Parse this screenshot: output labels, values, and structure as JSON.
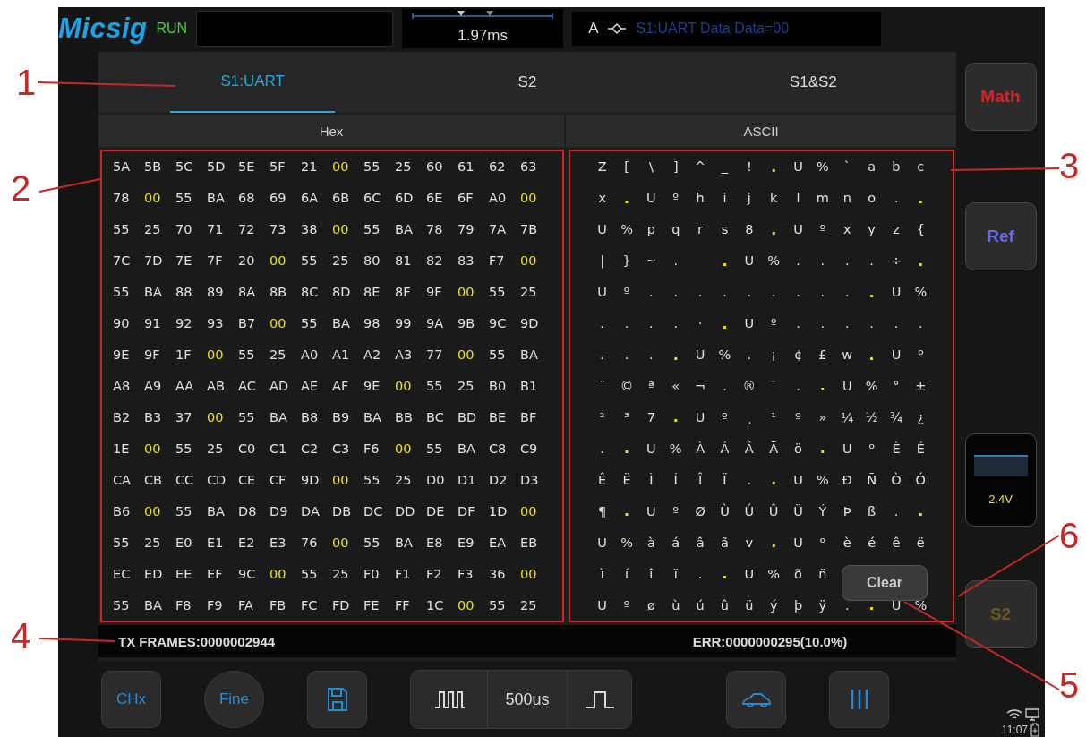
{
  "top_bar": {
    "logo": "Micsig",
    "run_state": "RUN",
    "timebase_position": "1.97ms",
    "trigger_source": "A",
    "trigger_description": "S1:UART Data Data=00"
  },
  "tabs": [
    {
      "label": "S1:UART",
      "selected": true
    },
    {
      "label": "S2",
      "selected": false
    },
    {
      "label": "S1&S2",
      "selected": false
    }
  ],
  "hex_panel": {
    "header": "Hex",
    "rows": [
      {
        "cells": [
          "5A",
          "5B",
          "5C",
          "5D",
          "5E",
          "5F",
          "21",
          "00",
          "55",
          "25",
          "60",
          "61",
          "62",
          "63"
        ],
        "highlighted": [
          false,
          false,
          false,
          false,
          false,
          false,
          false,
          true,
          false,
          false,
          false,
          false,
          false,
          false
        ]
      },
      {
        "cells": [
          "78",
          "00",
          "55",
          "BA",
          "68",
          "69",
          "6A",
          "6B",
          "6C",
          "6D",
          "6E",
          "6F",
          "A0",
          "00"
        ],
        "highlighted": [
          false,
          true,
          false,
          false,
          false,
          false,
          false,
          false,
          false,
          false,
          false,
          false,
          false,
          true
        ]
      },
      {
        "cells": [
          "55",
          "25",
          "70",
          "71",
          "72",
          "73",
          "38",
          "00",
          "55",
          "BA",
          "78",
          "79",
          "7A",
          "7B"
        ],
        "highlighted": [
          false,
          false,
          false,
          false,
          false,
          false,
          false,
          true,
          false,
          false,
          false,
          false,
          false,
          false
        ]
      },
      {
        "cells": [
          "7C",
          "7D",
          "7E",
          "7F",
          "20",
          "00",
          "55",
          "25",
          "80",
          "81",
          "82",
          "83",
          "F7",
          "00"
        ],
        "highlighted": [
          false,
          false,
          false,
          false,
          false,
          true,
          false,
          false,
          false,
          false,
          false,
          false,
          false,
          true
        ]
      },
      {
        "cells": [
          "55",
          "BA",
          "88",
          "89",
          "8A",
          "8B",
          "8C",
          "8D",
          "8E",
          "8F",
          "9F",
          "00",
          "55",
          "25"
        ],
        "highlighted": [
          false,
          false,
          false,
          false,
          false,
          false,
          false,
          false,
          false,
          false,
          false,
          true,
          false,
          false
        ]
      },
      {
        "cells": [
          "90",
          "91",
          "92",
          "93",
          "B7",
          "00",
          "55",
          "BA",
          "98",
          "99",
          "9A",
          "9B",
          "9C",
          "9D"
        ],
        "highlighted": [
          false,
          false,
          false,
          false,
          false,
          true,
          false,
          false,
          false,
          false,
          false,
          false,
          false,
          false
        ]
      },
      {
        "cells": [
          "9E",
          "9F",
          "1F",
          "00",
          "55",
          "25",
          "A0",
          "A1",
          "A2",
          "A3",
          "77",
          "00",
          "55",
          "BA"
        ],
        "highlighted": [
          false,
          false,
          false,
          true,
          false,
          false,
          false,
          false,
          false,
          false,
          false,
          true,
          false,
          false
        ]
      },
      {
        "cells": [
          "A8",
          "A9",
          "AA",
          "AB",
          "AC",
          "AD",
          "AE",
          "AF",
          "9E",
          "00",
          "55",
          "25",
          "B0",
          "B1"
        ],
        "highlighted": [
          false,
          false,
          false,
          false,
          false,
          false,
          false,
          false,
          false,
          true,
          false,
          false,
          false,
          false
        ]
      },
      {
        "cells": [
          "B2",
          "B3",
          "37",
          "00",
          "55",
          "BA",
          "B8",
          "B9",
          "BA",
          "BB",
          "BC",
          "BD",
          "BE",
          "BF"
        ],
        "highlighted": [
          false,
          false,
          false,
          true,
          false,
          false,
          false,
          false,
          false,
          false,
          false,
          false,
          false,
          false
        ]
      },
      {
        "cells": [
          "1E",
          "00",
          "55",
          "25",
          "C0",
          "C1",
          "C2",
          "C3",
          "F6",
          "00",
          "55",
          "BA",
          "C8",
          "C9"
        ],
        "highlighted": [
          false,
          true,
          false,
          false,
          false,
          false,
          false,
          false,
          false,
          true,
          false,
          false,
          false,
          false
        ]
      },
      {
        "cells": [
          "CA",
          "CB",
          "CC",
          "CD",
          "CE",
          "CF",
          "9D",
          "00",
          "55",
          "25",
          "D0",
          "D1",
          "D2",
          "D3"
        ],
        "highlighted": [
          false,
          false,
          false,
          false,
          false,
          false,
          false,
          true,
          false,
          false,
          false,
          false,
          false,
          false
        ]
      },
      {
        "cells": [
          "B6",
          "00",
          "55",
          "BA",
          "D8",
          "D9",
          "DA",
          "DB",
          "DC",
          "DD",
          "DE",
          "DF",
          "1D",
          "00"
        ],
        "highlighted": [
          false,
          true,
          false,
          false,
          false,
          false,
          false,
          false,
          false,
          false,
          false,
          false,
          false,
          true
        ]
      },
      {
        "cells": [
          "55",
          "25",
          "E0",
          "E1",
          "E2",
          "E3",
          "76",
          "00",
          "55",
          "BA",
          "E8",
          "E9",
          "EA",
          "EB"
        ],
        "highlighted": [
          false,
          false,
          false,
          false,
          false,
          false,
          false,
          true,
          false,
          false,
          false,
          false,
          false,
          false
        ]
      },
      {
        "cells": [
          "EC",
          "ED",
          "EE",
          "EF",
          "9C",
          "00",
          "55",
          "25",
          "F0",
          "F1",
          "F2",
          "F3",
          "36",
          "00"
        ],
        "highlighted": [
          false,
          false,
          false,
          false,
          false,
          true,
          false,
          false,
          false,
          false,
          false,
          false,
          false,
          true
        ]
      },
      {
        "cells": [
          "55",
          "BA",
          "F8",
          "F9",
          "FA",
          "FB",
          "FC",
          "FD",
          "FE",
          "FF",
          "1C",
          "00",
          "55",
          "25"
        ],
        "highlighted": [
          false,
          false,
          false,
          false,
          false,
          false,
          false,
          false,
          false,
          false,
          false,
          true,
          false,
          false
        ]
      }
    ]
  },
  "ascii_panel": {
    "header": "ASCII",
    "rows": [
      {
        "cells": [
          "Z",
          "[",
          "\\",
          "]",
          "^",
          "_",
          "!",
          ".",
          "U",
          "%",
          "`",
          "a",
          "b",
          "c"
        ],
        "highlighted": [
          false,
          false,
          false,
          false,
          false,
          false,
          false,
          true,
          false,
          false,
          false,
          false,
          false,
          false
        ]
      },
      {
        "cells": [
          "x",
          ".",
          "U",
          "º",
          "h",
          "i",
          "j",
          "k",
          "l",
          "m",
          "n",
          "o",
          ".",
          "."
        ],
        "highlighted": [
          false,
          true,
          false,
          false,
          false,
          false,
          false,
          false,
          false,
          false,
          false,
          false,
          false,
          true
        ]
      },
      {
        "cells": [
          "U",
          "%",
          "p",
          "q",
          "r",
          "s",
          "8",
          ".",
          "U",
          "º",
          "x",
          "y",
          "z",
          "{"
        ],
        "highlighted": [
          false,
          false,
          false,
          false,
          false,
          false,
          false,
          true,
          false,
          false,
          false,
          false,
          false,
          false
        ]
      },
      {
        "cells": [
          "|",
          "}",
          "~",
          ".",
          " ",
          ".",
          "U",
          "%",
          ".",
          ".",
          ".",
          ".",
          "÷",
          "."
        ],
        "highlighted": [
          false,
          false,
          false,
          false,
          false,
          true,
          false,
          false,
          false,
          false,
          false,
          false,
          false,
          true
        ]
      },
      {
        "cells": [
          "U",
          "º",
          ".",
          ".",
          ".",
          ".",
          ".",
          ".",
          ".",
          ".",
          ".",
          ".",
          "U",
          "%"
        ],
        "highlighted": [
          false,
          false,
          false,
          false,
          false,
          false,
          false,
          false,
          false,
          false,
          false,
          true,
          false,
          false
        ]
      },
      {
        "cells": [
          ".",
          ".",
          ".",
          ".",
          "·",
          ".",
          "U",
          "º",
          ".",
          ".",
          ".",
          ".",
          ".",
          "."
        ],
        "highlighted": [
          false,
          false,
          false,
          false,
          false,
          true,
          false,
          false,
          false,
          false,
          false,
          false,
          false,
          false
        ]
      },
      {
        "cells": [
          ".",
          ".",
          ".",
          ".",
          "U",
          "%",
          ".",
          "¡",
          "¢",
          "£",
          "w",
          ".",
          "U",
          "º"
        ],
        "highlighted": [
          false,
          false,
          false,
          true,
          false,
          false,
          false,
          false,
          false,
          false,
          false,
          true,
          false,
          false
        ]
      },
      {
        "cells": [
          "¨",
          "©",
          "ª",
          "«",
          "¬",
          ".",
          "®",
          "¯",
          ".",
          ".",
          "U",
          "%",
          "°",
          "±"
        ],
        "highlighted": [
          false,
          false,
          false,
          false,
          false,
          false,
          false,
          false,
          false,
          true,
          false,
          false,
          false,
          false
        ]
      },
      {
        "cells": [
          "²",
          "³",
          "7",
          ".",
          "U",
          "º",
          "¸",
          "¹",
          "º",
          "»",
          "¼",
          "½",
          "¾",
          "¿"
        ],
        "highlighted": [
          false,
          false,
          false,
          true,
          false,
          false,
          false,
          false,
          false,
          false,
          false,
          false,
          false,
          false
        ]
      },
      {
        "cells": [
          ".",
          ".",
          "U",
          "%",
          "À",
          "Á",
          "Â",
          "Ã",
          "ö",
          ".",
          "U",
          "º",
          "È",
          "É"
        ],
        "highlighted": [
          false,
          true,
          false,
          false,
          false,
          false,
          false,
          false,
          false,
          true,
          false,
          false,
          false,
          false
        ]
      },
      {
        "cells": [
          "Ê",
          "Ë",
          "Ì",
          "Í",
          "Î",
          "Ï",
          ".",
          ".",
          "U",
          "%",
          "Ð",
          "Ñ",
          "Ò",
          "Ó"
        ],
        "highlighted": [
          false,
          false,
          false,
          false,
          false,
          false,
          false,
          true,
          false,
          false,
          false,
          false,
          false,
          false
        ]
      },
      {
        "cells": [
          "¶",
          ".",
          "U",
          "º",
          "Ø",
          "Ù",
          "Ú",
          "Û",
          "Ü",
          "Ý",
          "Þ",
          "ß",
          ".",
          "."
        ],
        "highlighted": [
          false,
          true,
          false,
          false,
          false,
          false,
          false,
          false,
          false,
          false,
          false,
          false,
          false,
          true
        ]
      },
      {
        "cells": [
          "U",
          "%",
          "à",
          "á",
          "â",
          "ã",
          "v",
          ".",
          "U",
          "º",
          "è",
          "é",
          "ê",
          "ë"
        ],
        "highlighted": [
          false,
          false,
          false,
          false,
          false,
          false,
          false,
          true,
          false,
          false,
          false,
          false,
          false,
          false
        ]
      },
      {
        "cells": [
          "ì",
          "í",
          "î",
          "ï",
          ".",
          ".",
          "U",
          "%",
          "ð",
          "ñ"
        ],
        "highlighted": [
          false,
          false,
          false,
          false,
          false,
          true,
          false,
          false,
          false,
          false
        ]
      },
      {
        "cells": [
          "U",
          "º",
          "ø",
          "ù",
          "ú",
          "û",
          "ü",
          "ý",
          "þ",
          "ÿ",
          ".",
          ".",
          "U",
          "%"
        ],
        "highlighted": [
          false,
          false,
          false,
          false,
          false,
          false,
          false,
          false,
          false,
          false,
          false,
          true,
          false,
          false
        ]
      }
    ]
  },
  "clear_button": "Clear",
  "status": {
    "tx_frames": "TX FRAMES:0000002944",
    "errors": "ERR:0000000295(10.0%)"
  },
  "side_buttons": [
    {
      "label": "Math",
      "kind": "math"
    },
    {
      "label": "Ref",
      "kind": "ref"
    },
    {
      "label": "2.4V",
      "kind": "channel"
    },
    {
      "label": "S2",
      "kind": "serial"
    }
  ],
  "toolbar": {
    "channel_button": "CHx",
    "fine_button": "Fine",
    "timebase": "500us"
  },
  "clock": "11:07",
  "callouts": [
    "1",
    "3",
    "2",
    "6",
    "4",
    "5"
  ]
}
